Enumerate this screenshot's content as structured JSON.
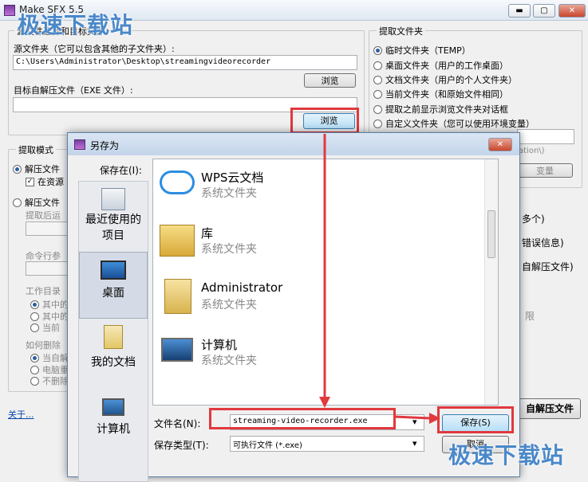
{
  "app": {
    "title": "Make SFX 5.5",
    "min": "▬",
    "max": "▢",
    "close": "✕"
  },
  "main": {
    "source_group": "源文件选择和目标文件",
    "source_label": "源文件夹（它可以包含其他的子文件夹）:",
    "source_value": "C:\\Users\\Administrator\\Desktop\\streamingvideorecorder",
    "browse1": "浏览",
    "target_label": "目标自解压文件（EXE 文件）:",
    "target_value": "",
    "browse2": "浏览",
    "extract_group": "提取文件夹",
    "extract_options": [
      "临时文件夹（TEMP）",
      "桌面文件夹（用户的工作桌面）",
      "文档文件夹（用户的个人文件夹）",
      "当前文件夹（和原始文件相同）",
      "提取之前显示浏览文件夹对话框",
      "自定义文件夹（您可以使用环境变量）"
    ],
    "ation_frag": "ation\\)",
    "change_frag": "变量",
    "mode_group": "提取模式",
    "mode1": "解压文件",
    "mode1_sub": "在资源",
    "mode2": "解压文件",
    "mode2_sub": "提取后运",
    "cmd_label": "命令行参",
    "workdir_label": "工作目录",
    "wd_opts": [
      "其中的",
      "其中的",
      "当前"
    ],
    "delete_label": "如何删除",
    "del_opts": [
      "当自解",
      "电脑重",
      "不删除"
    ],
    "right_frag1": "多个)",
    "right_frag2": "错误信息)",
    "right_frag3": "自解压文件)",
    "right_frag4": "限",
    "about": "关于...",
    "create_btn": "自解压文件"
  },
  "dialog": {
    "title": "另存为",
    "save_in_label": "保存在(I):",
    "save_in_value": "桌面",
    "places": [
      "最近使用的项目",
      "桌面",
      "我的文档",
      "计算机"
    ],
    "files": [
      {
        "name": "WPS云文档",
        "type": "系统文件夹"
      },
      {
        "name": "库",
        "type": "系统文件夹"
      },
      {
        "name": "Administrator",
        "type": "系统文件夹"
      },
      {
        "name": "计算机",
        "type": "系统文件夹"
      }
    ],
    "filename_label": "文件名(N):",
    "filename_value": "streaming-video-recorder.exe",
    "filetype_label": "保存类型(T):",
    "filetype_value": "可执行文件 (*.exe)",
    "save_btn": "保存(S)",
    "cancel_btn": "取消"
  },
  "watermark": "极速下载站"
}
